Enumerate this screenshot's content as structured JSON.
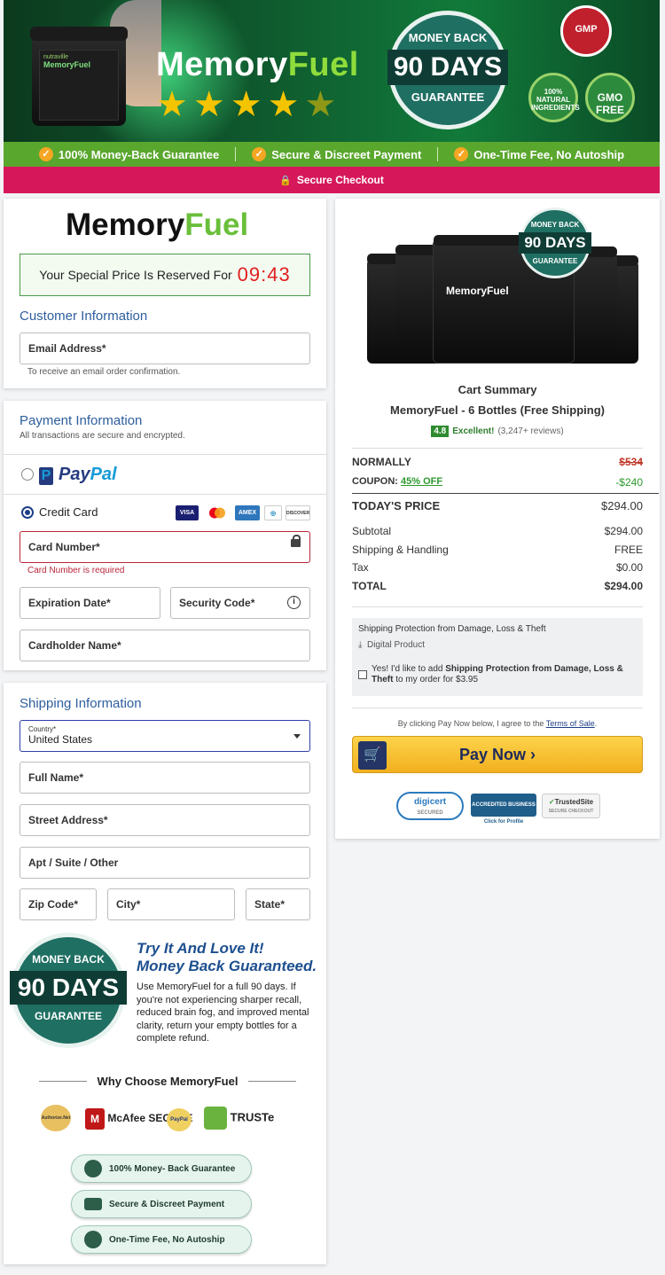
{
  "banner": {
    "jar_brand": "nutraville",
    "jar_name": "MemoryFuel",
    "brand_memory": "Memory",
    "brand_fuel": "Fuel",
    "rating_stars": 4.5,
    "seal_top": "MONEY BACK",
    "seal_mid": "90 DAYS",
    "seal_bot": "GUARANTEE",
    "gmp": "GMP",
    "natural": "100% NATURAL INGREDIENTS",
    "gmo": "GMO FREE"
  },
  "trustbar": [
    "100% Money-Back Guarantee",
    "Secure & Discreet Payment",
    "One-Time Fee, No Autoship"
  ],
  "secure_checkout": "Secure Checkout",
  "left": {
    "logo_memory": "Memory",
    "logo_fuel": "Fuel",
    "timer_label": "Your Special Price Is Reserved For",
    "timer_value": "09:43",
    "customer_title": "Customer Information",
    "email_placeholder": "Email Address*",
    "email_hint": "To receive an email order confirmation.",
    "payment_title": "Payment Information",
    "payment_sub": "All transactions are secure and encrypted.",
    "paypal_pay": "Pay",
    "paypal_pal": "Pal",
    "credit_card": "Credit Card",
    "card_icons": [
      "VISA",
      "MC",
      "AMEX",
      "DINERS",
      "DISCOVER"
    ],
    "card_number": "Card Number*",
    "card_error": "Card Number is required",
    "expiration": "Expiration Date*",
    "security_code": "Security Code*",
    "cardholder": "Cardholder Name*",
    "shipping_title": "Shipping Information",
    "country_label": "Country*",
    "country_value": "United States",
    "full_name": "Full Name*",
    "street": "Street Address*",
    "apt": "Apt / Suite / Other",
    "zip": "Zip Code*",
    "city": "City*",
    "state": "State*",
    "try_line1": "Try It And Love It!",
    "try_line2": "Money Back Guaranteed.",
    "try_text": "Use MemoryFuel for a full 90 days. If you're not experiencing sharper recall, reduced brain fog, and improved mental clarity, return your empty bottles for a complete refund.",
    "why_title": "Why Choose MemoryFuel",
    "trust_logos": [
      "Authorize.Net",
      "McAfee SECURE",
      "PayPal",
      "TRUSTe"
    ],
    "pills": [
      "100% Money- Back Guarantee",
      "Secure & Discreet Payment",
      "One-Time Fee, No Autoship"
    ]
  },
  "right": {
    "cart_summary": "Cart Summary",
    "product": "MemoryFuel - 6 Bottles (Free Shipping)",
    "rating_score": "4.8",
    "rating_word": "Excellent!",
    "reviews": "(3,247+ reviews)",
    "normally_label": "NORMALLY",
    "normally_value": "$534",
    "coupon_label": "COUPON:",
    "coupon_pct": "45% OFF",
    "coupon_value": "-$240",
    "today_label": "TODAY'S PRICE",
    "today_value": "$294.00",
    "subtotal_label": "Subtotal",
    "subtotal_value": "$294.00",
    "shipping_label": "Shipping & Handling",
    "shipping_value": "FREE",
    "tax_label": "Tax",
    "tax_value": "$0.00",
    "total_label": "TOTAL",
    "total_value": "$294.00",
    "protection_title": "Shipping Protection from Damage, Loss & Theft",
    "digital": "Digital Product",
    "protection_offer_pre": "Yes! I'd like to add",
    "protection_offer_bold": "Shipping Protection from Damage, Loss & Theft",
    "protection_offer_post": "to my order for $3.95",
    "agree_pre": "By clicking Pay Now below, I agree to the",
    "terms": "Terms of Sale",
    "pay_now": "Pay Now",
    "digicert": "digicert",
    "digicert_sub": "SECURED",
    "bbb": "ACCREDITED BUSINESS",
    "bbb_sub": "Click for Profile",
    "trustedsite": "TrustedSite",
    "trustedsite_sub": "SECURE CHECKOUT"
  },
  "colors": {
    "accent_green": "#5aa72e",
    "checkout_pink": "#d6185a",
    "section_blue": "#2d5e9e",
    "pay_yellow": "#f2b01e"
  }
}
